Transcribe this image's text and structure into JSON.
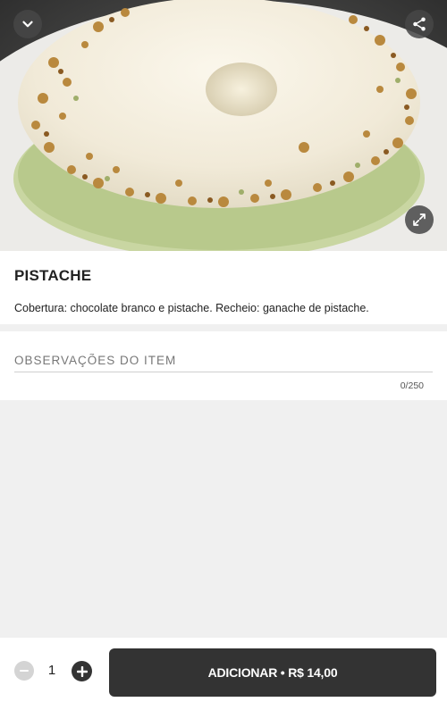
{
  "product": {
    "name": "PISTACHE",
    "description": "Cobertura: chocolate branco e pistache. Recheio: ganache de pistache."
  },
  "notes": {
    "placeholder": "OBSERVAÇÕES DO ITEM",
    "value": "",
    "counter": "0/250"
  },
  "cart": {
    "quantity": "1",
    "add_label": "ADICIONAR • R$ 14,00"
  },
  "icons": {
    "collapse": "chevron-down-icon",
    "share": "share-icon",
    "expand": "expand-icon",
    "decrease": "minus-icon",
    "increase": "plus-icon"
  },
  "colors": {
    "primary_button": "#333333",
    "disabled_button": "#d4d4d4",
    "background": "#f0f0f0"
  }
}
